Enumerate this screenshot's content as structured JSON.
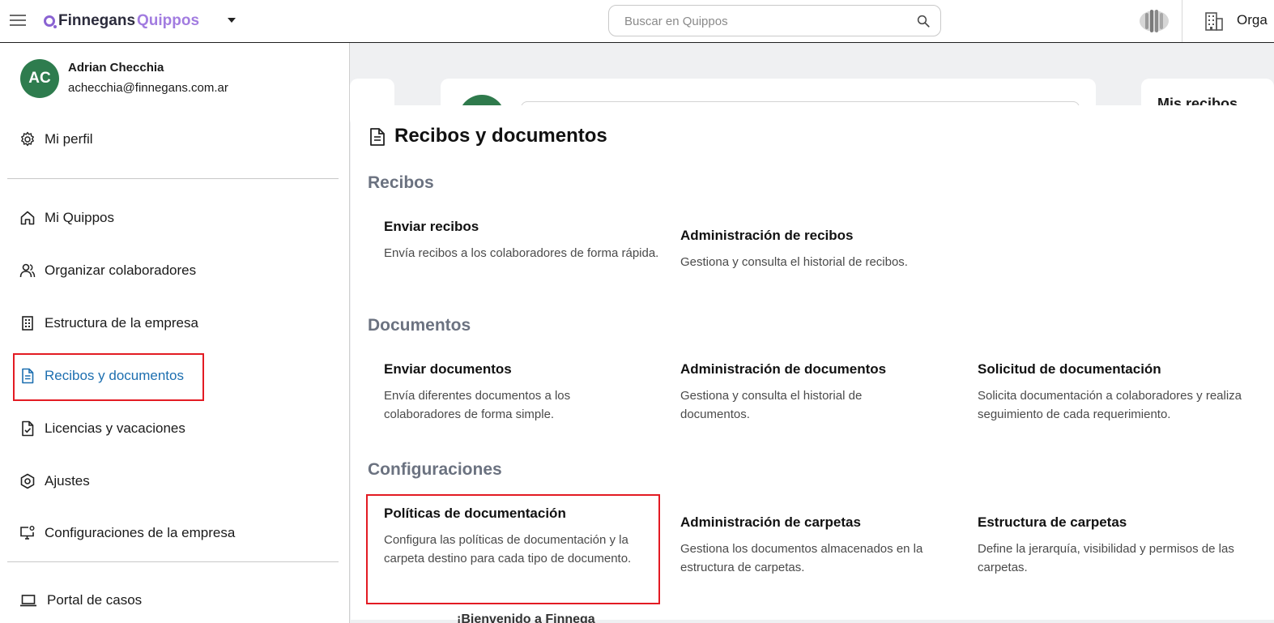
{
  "header": {
    "logo_primary": "Finnegans",
    "logo_secondary": "Quippos",
    "search_placeholder": "Buscar en Quippos",
    "org_label": "Orga"
  },
  "background": {
    "right_card_title": "Mis recibos",
    "bottom_text": "¡Bienvenido a Finnega"
  },
  "user": {
    "initials": "AC",
    "name": "Adrian Checchia",
    "email": "achecchia@finnegans.com.ar"
  },
  "sidebar": {
    "profile_label": "Mi perfil",
    "items": [
      {
        "label": "Mi Quippos",
        "icon": "home-icon"
      },
      {
        "label": "Organizar colaboradores",
        "icon": "users-icon"
      },
      {
        "label": "Estructura de la empresa",
        "icon": "building-icon"
      },
      {
        "label": "Recibos y documentos",
        "icon": "document-icon",
        "active": true
      },
      {
        "label": "Licencias y vacaciones",
        "icon": "file-check-icon"
      },
      {
        "label": "Ajustes",
        "icon": "hexagon-settings-icon"
      },
      {
        "label": "Configuraciones de la empresa",
        "icon": "monitor-settings-icon"
      }
    ],
    "footer_label": "Portal de casos"
  },
  "panel": {
    "title": "Recibos y documentos",
    "sections": [
      {
        "title": "Recibos",
        "cards": [
          {
            "title": "Enviar recibos",
            "desc": "Envía recibos a los colaboradores de forma rápida."
          },
          {
            "title": "Administración de recibos",
            "desc": "Gestiona y consulta el historial de recibos."
          }
        ]
      },
      {
        "title": "Documentos",
        "cards": [
          {
            "title": "Enviar documentos",
            "desc": "Envía diferentes documentos a los colaboradores de forma simple."
          },
          {
            "title": "Administración de documentos",
            "desc": "Gestiona y consulta el historial de documentos."
          },
          {
            "title": "Solicitud de documentación",
            "desc": "Solicita documentación a colaboradores y realiza seguimiento de cada requerimiento."
          }
        ]
      },
      {
        "title": "Configuraciones",
        "cards": [
          {
            "title": "Políticas de documentación",
            "desc": "Configura las políticas de documentación y la carpeta destino para cada tipo de documento."
          },
          {
            "title": "Administración de carpetas",
            "desc": "Gestiona los documentos almacenados en la estructura de carpetas."
          },
          {
            "title": "Estructura de carpetas",
            "desc": "Define la jerarquía, visibilidad y permisos de las carpetas."
          }
        ]
      }
    ]
  },
  "colors": {
    "accent_purple": "#a27ce0",
    "avatar_green": "#2e7c4e",
    "active_blue": "#1d6fb0",
    "highlight_red": "#e31b23",
    "section_gray": "#6b7280"
  }
}
